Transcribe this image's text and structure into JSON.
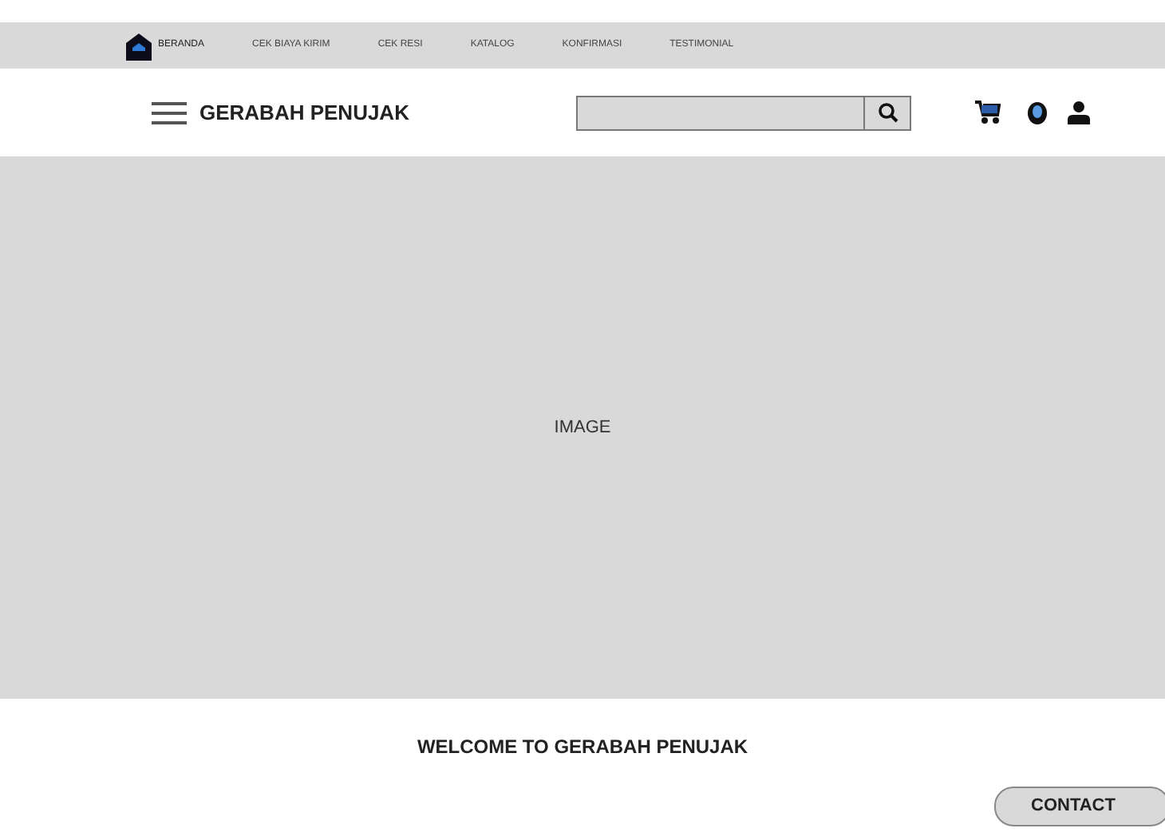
{
  "nav": {
    "items": [
      {
        "label": "BERANDA",
        "selected": true
      },
      {
        "label": "CEK BIAYA KIRIM",
        "selected": false
      },
      {
        "label": "CEK RESI",
        "selected": false
      },
      {
        "label": "KATALOG",
        "selected": false
      },
      {
        "label": "KONFIRMASI",
        "selected": false
      },
      {
        "label": "TESTIMONIAL",
        "selected": false
      }
    ]
  },
  "header": {
    "brand": "GERABAH PENUJAK"
  },
  "hero": {
    "label": "IMAGE"
  },
  "welcome": "WELCOME TO GERABAH PENUJAK",
  "contact_button": "CONTACT"
}
